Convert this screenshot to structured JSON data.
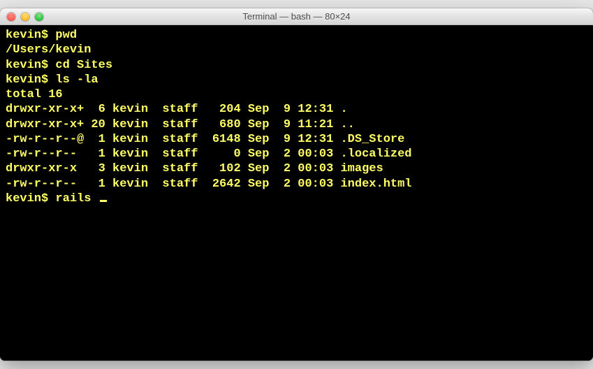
{
  "window": {
    "title": "Terminal — bash — 80×24"
  },
  "prompt": "kevin$ ",
  "session": [
    {
      "type": "cmd",
      "text": "pwd"
    },
    {
      "type": "out",
      "text": "/Users/kevin"
    },
    {
      "type": "cmd",
      "text": "cd Sites"
    },
    {
      "type": "cmd",
      "text": "ls -la"
    },
    {
      "type": "out",
      "text": "total 16"
    },
    {
      "type": "out",
      "text": "drwxr-xr-x+  6 kevin  staff   204 Sep  9 12:31 ."
    },
    {
      "type": "out",
      "text": "drwxr-xr-x+ 20 kevin  staff   680 Sep  9 11:21 .."
    },
    {
      "type": "out",
      "text": "-rw-r--r--@  1 kevin  staff  6148 Sep  9 12:31 .DS_Store"
    },
    {
      "type": "out",
      "text": "-rw-r--r--   1 kevin  staff     0 Sep  2 00:03 .localized"
    },
    {
      "type": "out",
      "text": "drwxr-xr-x   3 kevin  staff   102 Sep  2 00:03 images"
    },
    {
      "type": "out",
      "text": "-rw-r--r--   1 kevin  staff  2642 Sep  2 00:03 index.html"
    },
    {
      "type": "cmd_active",
      "text": "rails "
    }
  ]
}
